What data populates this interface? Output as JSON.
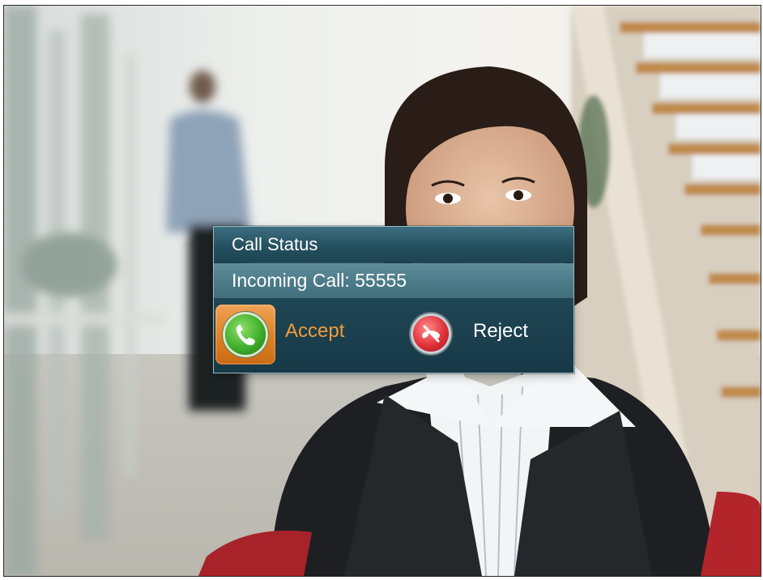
{
  "dialog": {
    "title": "Call Status",
    "message": "Incoming Call: 55555",
    "accept_label": "Accept",
    "reject_label": "Reject"
  },
  "icons": {
    "accept": "green-phone-answer-icon",
    "reject": "red-phone-hangup-icon"
  },
  "colors": {
    "accept_text": "#f39a3c",
    "accept_tile": "#e07f23",
    "dialog_bg": "#1f4655"
  }
}
